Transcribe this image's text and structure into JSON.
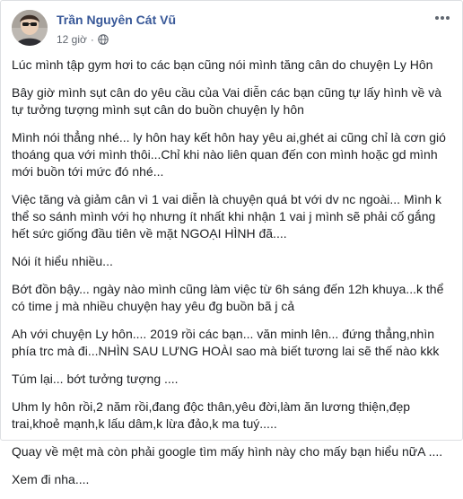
{
  "post": {
    "author": "Trần Nguyên Cát Vũ",
    "time": "12 giờ",
    "dot": "·",
    "privacy_icon": "globe-icon",
    "more_icon": "more-options-icon",
    "paragraphs": [
      "Lúc mình tập gym hơi to các bạn cũng nói mình tăng cân do chuyện Ly Hôn",
      "Bây giờ mình sụt cân do yêu cầu của Vai diễn các bạn cũng tự lấy hình về và tự tưởng tượng mình sụt cân do buồn chuyện ly hôn",
      "Mình nói thẳng nhé... ly hôn hay kết hôn hay yêu ai,ghét ai cũng chỉ là cơn gió thoáng qua với mình thôi...Chỉ khi nào liên quan đến con mình hoặc gd mình mới buồn tới mức đó nhé...",
      "Việc tăng và giảm cân vì 1 vai diễn là chuyện quá bt với dv nc ngoài... Mình k thể so sánh mình với họ nhưng ít nhất khi nhận 1 vai j mình sẽ phải cố gắng hết sức giống đầu tiên về mặt NGOẠI HÌNH đã....",
      "Nói ít hiểu nhiều...",
      "Bớt đồn bậy... ngày nào mình cũng làm việc từ 6h sáng đến 12h khuya...k thể có time j mà nhiều chuyện hay yêu đg buồn bã j cả",
      "Ah với chuyện Ly hôn.... 2019 rồi các bạn... văn minh lên... đứng thẳng,nhìn phía trc mà đi...NHÌN SAU LƯNG HOÀI sao mà biết tương lai sẽ thế nào kkk",
      "Túm lại... bớt tưởng tượng ....",
      "Uhm ly hôn rồi,2 năm rồi,đang độc thân,yêu đời,làm ăn lương thiện,đẹp trai,khoẻ mạnh,k lấu dâm,k lừa đảo,k ma tuý.....",
      "Quay về mệt mà còn phải google tìm mấy hình này cho mấy bạn hiểu nữA ....",
      "Xem đi nha...."
    ]
  }
}
